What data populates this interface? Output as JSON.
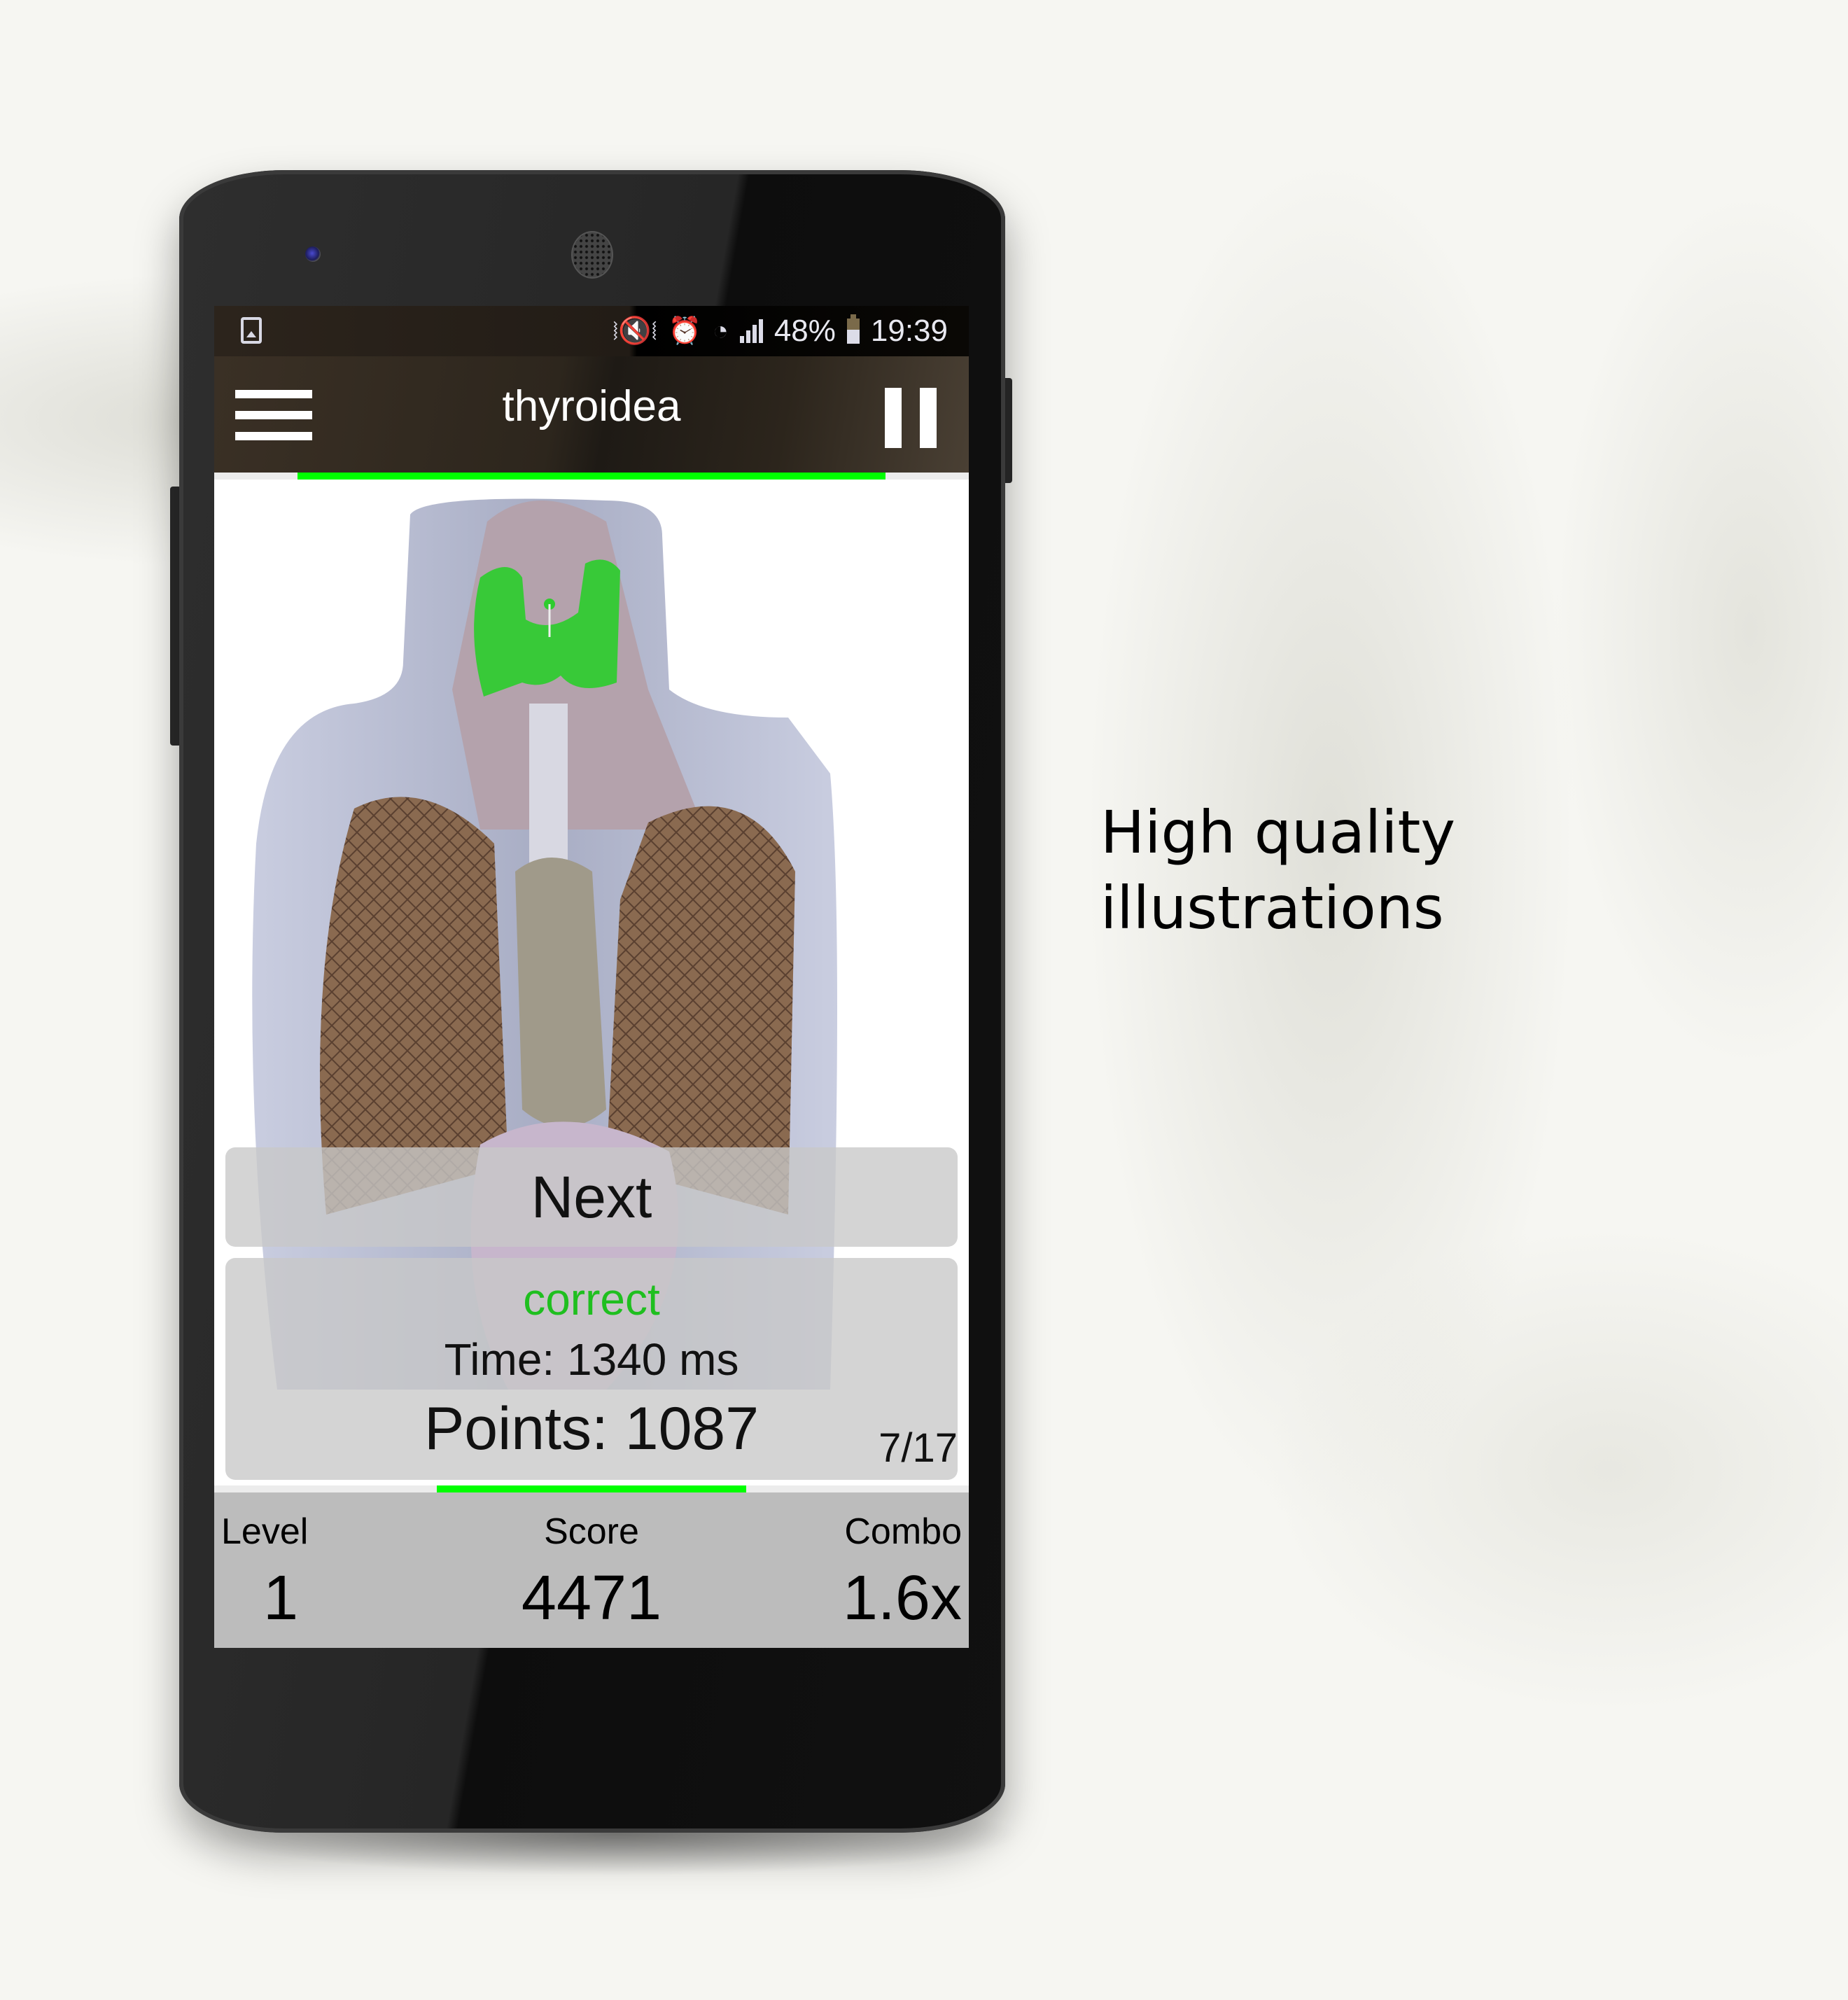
{
  "caption": {
    "line1": "High quality",
    "line2": "illustrations"
  },
  "status_bar": {
    "left_icon": "gallery-icon",
    "icons": [
      "vibrate-mute-icon",
      "alarm-icon",
      "wifi-icon",
      "signal-icon"
    ],
    "battery_percent": "48%",
    "battery_icon": "battery-icon",
    "time": "19:39"
  },
  "app_bar": {
    "menu_icon": "hamburger-menu-icon",
    "title": "thyroidea",
    "pause_icon": "pause-icon"
  },
  "timer_progress": 0.78,
  "illustration": {
    "subject": "anatomical illustration of thorax and neck",
    "highlighted_structure": "thyroidea",
    "highlight_color": "#2ecc2e"
  },
  "next_button": {
    "label": "Next"
  },
  "result": {
    "status": "correct",
    "status_color": "#1fbf1f",
    "time": "Time: 1340 ms",
    "points": "Points: 1087",
    "question_counter": "7/17"
  },
  "question_progress": 0.41,
  "stats": {
    "level_label": "Level",
    "level_value": "1",
    "score_label": "Score",
    "score_value": "4471",
    "combo_label": "Combo",
    "combo_value": "1.6x"
  },
  "colors": {
    "progress": "#00ff00",
    "stats_bg": "#bcbcbc",
    "appbar_bg": "#2d261d"
  }
}
